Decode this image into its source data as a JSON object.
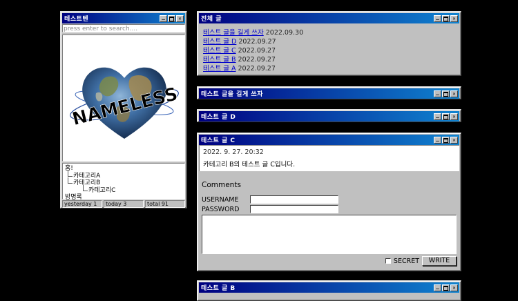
{
  "left_window": {
    "title": "테스트텐",
    "search_placeholder": "press enter to search....",
    "logo_text": "NAMELESS",
    "categories": {
      "home": "홈!",
      "cat_a": "카테고리A",
      "cat_b": "카테고리B",
      "cat_c": "카테고리C",
      "guestbook": "방명록"
    },
    "status": {
      "yesterday": "yesterday 1",
      "today": "today 3",
      "total": "total 91"
    }
  },
  "all_posts": {
    "title": "전체 글",
    "items": [
      {
        "label": "테스트 글을 길게 쓰자",
        "date": "2022.09.30"
      },
      {
        "label": "테스트 글 D",
        "date": "2022.09.27"
      },
      {
        "label": "테스트 글 C",
        "date": "2022.09.27"
      },
      {
        "label": "테스트 글 B",
        "date": "2022.09.27"
      },
      {
        "label": "테스트 글 A",
        "date": "2022.09.27"
      }
    ]
  },
  "post_long": {
    "title": "테스트 글을 길게 쓰자"
  },
  "post_d": {
    "title": "테스트 글 D"
  },
  "post_c": {
    "title": "테스트 글 C",
    "date": "2022. 9. 27. 20:32",
    "text": "카테고리 B의 테스트 글 C입니다.",
    "comments_heading": "Comments",
    "username_label": "USERNAME",
    "password_label": "PASSWORD",
    "secret_label": "SECRET",
    "write_label": "WRITE"
  },
  "post_b": {
    "title": "테스트 글 B"
  },
  "colors": {
    "titlebar_start": "#000080",
    "titlebar_end": "#1084d0",
    "window_face": "#c0c0c0",
    "link": "#0000cc",
    "desktop": "#000000"
  }
}
